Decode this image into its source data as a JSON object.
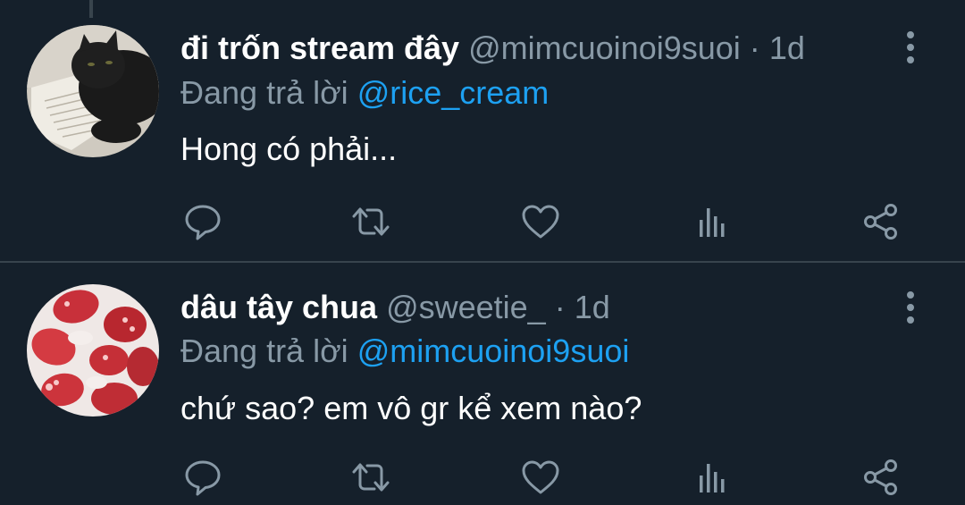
{
  "tweets": [
    {
      "display_name": "đi trốn stream đây",
      "handle": "@mimcuoinoi9suoi",
      "separator": "·",
      "time": "1d",
      "reply_prefix": "Đang trả lời",
      "reply_to": "@rice_cream",
      "text": "Hong có phải..."
    },
    {
      "display_name": "dâu tây chua",
      "handle": "@sweetie_",
      "separator": "·",
      "time": "1d",
      "reply_prefix": "Đang trả lời",
      "reply_to": "@mimcuoinoi9suoi",
      "text": "chứ sao? em vô gr kể xem nào?"
    }
  ],
  "icons": {
    "reply": "comment-icon",
    "retweet": "retweet-icon",
    "like": "heart-icon",
    "views": "analytics-icon",
    "share": "share-icon",
    "more": "more-vertical-icon"
  },
  "colors": {
    "background": "#15202b",
    "text": "#ffffff",
    "muted": "#8899a6",
    "accent": "#1da1f2",
    "divider": "#38444d"
  }
}
